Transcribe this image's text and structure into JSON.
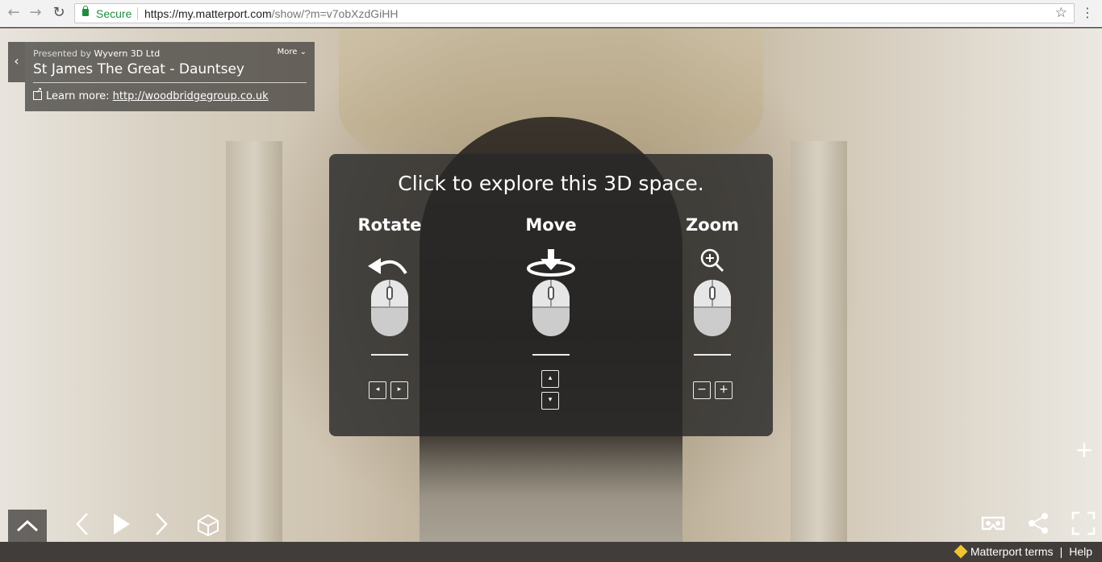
{
  "browser": {
    "secure_label": "Secure",
    "url_main": "https://my.matterport.com",
    "url_path": "/show/?m=v7obXzdGiHH"
  },
  "info": {
    "presented_prefix": "Presented by",
    "presenter": "Wyvern 3D Ltd",
    "title": "St James The Great - Dauntsey",
    "more_label": "More",
    "learn_label": "Learn more:",
    "learn_link": "http://woodbridgegroup.co.uk"
  },
  "help": {
    "title": "Click to explore this 3D space.",
    "rotate_label": "Rotate",
    "move_label": "Move",
    "zoom_label": "Zoom"
  },
  "footer": {
    "terms_label": "Matterport terms",
    "separator": "|",
    "help_label": "Help"
  },
  "icons": {
    "back": "chevron-left-icon",
    "forward": "chevron-right-icon",
    "reload": "reload-icon",
    "star": "star-icon",
    "menu": "kebab-menu-icon"
  }
}
